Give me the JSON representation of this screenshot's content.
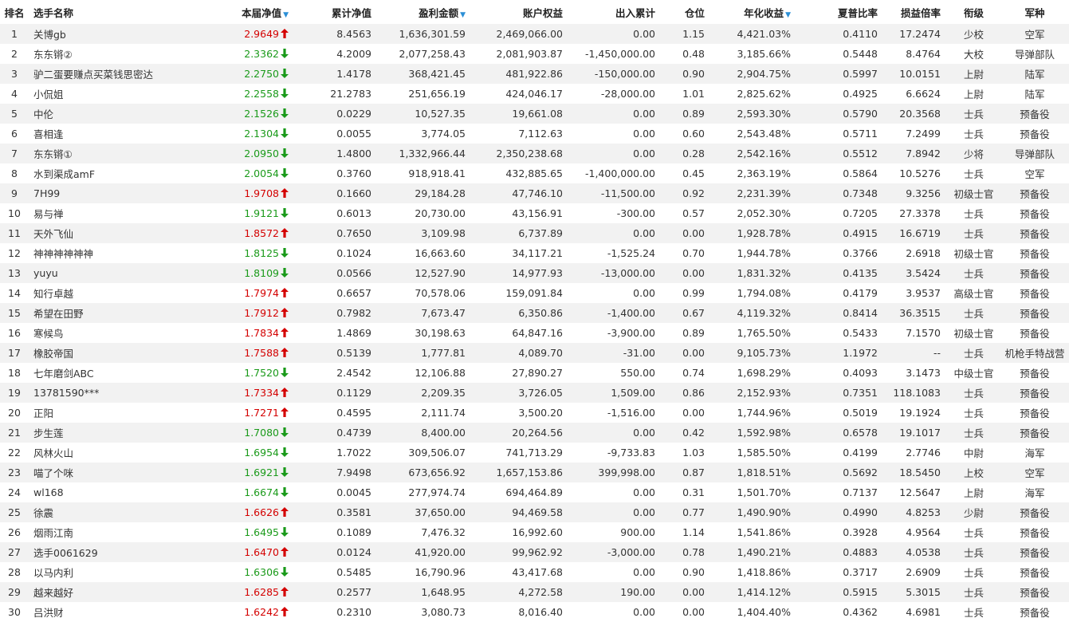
{
  "columns": {
    "rank": "排名",
    "name": "选手名称",
    "nav": "本届净值",
    "cum_nav": "累计净值",
    "profit": "盈利金额",
    "equity": "账户权益",
    "flow": "出入累计",
    "position": "仓位",
    "annual": "年化收益",
    "sharpe": "夏普比率",
    "pl_ratio": "损益倍率",
    "rank_title": "衔级",
    "army": "军种"
  },
  "sort_indicator": "▼",
  "icons": {
    "up": "arrow-up-icon",
    "down": "arrow-down-icon"
  },
  "colors": {
    "up": "#d40000",
    "down": "#1a9a1a",
    "sort": "#2b8fd6",
    "row_alt": "#f2f2f2"
  },
  "rows": [
    {
      "rank": "1",
      "name": "关博gb",
      "nav": "2.9649",
      "dir": "up",
      "cum": "8.4563",
      "profit": "1,636,301.59",
      "equity": "2,469,066.00",
      "flow": "0.00",
      "pos": "1.15",
      "annual": "4,421.03%",
      "sharpe": "0.4110",
      "pl": "17.2474",
      "title": "少校",
      "army": "空军"
    },
    {
      "rank": "2",
      "name": "东东锵②",
      "nav": "2.3362",
      "dir": "down",
      "cum": "4.2009",
      "profit": "2,077,258.43",
      "equity": "2,081,903.87",
      "flow": "-1,450,000.00",
      "pos": "0.48",
      "annual": "3,185.66%",
      "sharpe": "0.5448",
      "pl": "8.4764",
      "title": "大校",
      "army": "导弹部队"
    },
    {
      "rank": "3",
      "name": "驴二蛋要赚点买菜钱思密达",
      "nav": "2.2750",
      "dir": "down",
      "cum": "1.4178",
      "profit": "368,421.45",
      "equity": "481,922.86",
      "flow": "-150,000.00",
      "pos": "0.90",
      "annual": "2,904.75%",
      "sharpe": "0.5997",
      "pl": "10.0151",
      "title": "上尉",
      "army": "陆军"
    },
    {
      "rank": "4",
      "name": "小侃姐",
      "nav": "2.2558",
      "dir": "down",
      "cum": "21.2783",
      "profit": "251,656.19",
      "equity": "424,046.17",
      "flow": "-28,000.00",
      "pos": "1.01",
      "annual": "2,825.62%",
      "sharpe": "0.4925",
      "pl": "6.6624",
      "title": "上尉",
      "army": "陆军"
    },
    {
      "rank": "5",
      "name": "中伦",
      "nav": "2.1526",
      "dir": "down",
      "cum": "0.0229",
      "profit": "10,527.35",
      "equity": "19,661.08",
      "flow": "0.00",
      "pos": "0.89",
      "annual": "2,593.30%",
      "sharpe": "0.5790",
      "pl": "20.3568",
      "title": "士兵",
      "army": "预备役"
    },
    {
      "rank": "6",
      "name": "喜相逢",
      "nav": "2.1304",
      "dir": "down",
      "cum": "0.0055",
      "profit": "3,774.05",
      "equity": "7,112.63",
      "flow": "0.00",
      "pos": "0.60",
      "annual": "2,543.48%",
      "sharpe": "0.5711",
      "pl": "7.2499",
      "title": "士兵",
      "army": "预备役"
    },
    {
      "rank": "7",
      "name": "东东锵①",
      "nav": "2.0950",
      "dir": "down",
      "cum": "1.4800",
      "profit": "1,332,966.44",
      "equity": "2,350,238.68",
      "flow": "0.00",
      "pos": "0.28",
      "annual": "2,542.16%",
      "sharpe": "0.5512",
      "pl": "7.8942",
      "title": "少将",
      "army": "导弹部队"
    },
    {
      "rank": "8",
      "name": "水到渠成amF",
      "nav": "2.0054",
      "dir": "down",
      "cum": "0.3760",
      "profit": "918,918.41",
      "equity": "432,885.65",
      "flow": "-1,400,000.00",
      "pos": "0.45",
      "annual": "2,363.19%",
      "sharpe": "0.5864",
      "pl": "10.5276",
      "title": "士兵",
      "army": "空军"
    },
    {
      "rank": "9",
      "name": "7H99",
      "nav": "1.9708",
      "dir": "up",
      "cum": "0.1660",
      "profit": "29,184.28",
      "equity": "47,746.10",
      "flow": "-11,500.00",
      "pos": "0.92",
      "annual": "2,231.39%",
      "sharpe": "0.7348",
      "pl": "9.3256",
      "title": "初级士官",
      "army": "预备役"
    },
    {
      "rank": "10",
      "name": "易与禅",
      "nav": "1.9121",
      "dir": "down",
      "cum": "0.6013",
      "profit": "20,730.00",
      "equity": "43,156.91",
      "flow": "-300.00",
      "pos": "0.57",
      "annual": "2,052.30%",
      "sharpe": "0.7205",
      "pl": "27.3378",
      "title": "士兵",
      "army": "预备役"
    },
    {
      "rank": "11",
      "name": "天外飞仙",
      "nav": "1.8572",
      "dir": "up",
      "cum": "0.7650",
      "profit": "3,109.98",
      "equity": "6,737.89",
      "flow": "0.00",
      "pos": "0.00",
      "annual": "1,928.78%",
      "sharpe": "0.4915",
      "pl": "16.6719",
      "title": "士兵",
      "army": "预备役"
    },
    {
      "rank": "12",
      "name": "神神神神神神",
      "nav": "1.8125",
      "dir": "down",
      "cum": "0.1024",
      "profit": "16,663.60",
      "equity": "34,117.21",
      "flow": "-1,525.24",
      "pos": "0.70",
      "annual": "1,944.78%",
      "sharpe": "0.3766",
      "pl": "2.6918",
      "title": "初级士官",
      "army": "预备役"
    },
    {
      "rank": "13",
      "name": "yuyu",
      "nav": "1.8109",
      "dir": "down",
      "cum": "0.0566",
      "profit": "12,527.90",
      "equity": "14,977.93",
      "flow": "-13,000.00",
      "pos": "0.00",
      "annual": "1,831.32%",
      "sharpe": "0.4135",
      "pl": "3.5424",
      "title": "士兵",
      "army": "预备役"
    },
    {
      "rank": "14",
      "name": "知行卓越",
      "nav": "1.7974",
      "dir": "up",
      "cum": "0.6657",
      "profit": "70,578.06",
      "equity": "159,091.84",
      "flow": "0.00",
      "pos": "0.99",
      "annual": "1,794.08%",
      "sharpe": "0.4179",
      "pl": "3.9537",
      "title": "高级士官",
      "army": "预备役"
    },
    {
      "rank": "15",
      "name": "希望在田野",
      "nav": "1.7912",
      "dir": "up",
      "cum": "0.7982",
      "profit": "7,673.47",
      "equity": "6,350.86",
      "flow": "-1,400.00",
      "pos": "0.67",
      "annual": "4,119.32%",
      "sharpe": "0.8414",
      "pl": "36.3515",
      "title": "士兵",
      "army": "预备役"
    },
    {
      "rank": "16",
      "name": "寒候鸟",
      "nav": "1.7834",
      "dir": "up",
      "cum": "1.4869",
      "profit": "30,198.63",
      "equity": "64,847.16",
      "flow": "-3,900.00",
      "pos": "0.89",
      "annual": "1,765.50%",
      "sharpe": "0.5433",
      "pl": "7.1570",
      "title": "初级士官",
      "army": "预备役"
    },
    {
      "rank": "17",
      "name": "橡胶帝国",
      "nav": "1.7588",
      "dir": "up",
      "cum": "0.5139",
      "profit": "1,777.81",
      "equity": "4,089.70",
      "flow": "-31.00",
      "pos": "0.00",
      "annual": "9,105.73%",
      "sharpe": "1.1972",
      "pl": "--",
      "title": "士兵",
      "army": "机枪手特战营"
    },
    {
      "rank": "18",
      "name": "七年磨剑ABC",
      "nav": "1.7520",
      "dir": "down",
      "cum": "2.4542",
      "profit": "12,106.88",
      "equity": "27,890.27",
      "flow": "550.00",
      "pos": "0.74",
      "annual": "1,698.29%",
      "sharpe": "0.4093",
      "pl": "3.1473",
      "title": "中级士官",
      "army": "预备役"
    },
    {
      "rank": "19",
      "name": "13781590***",
      "nav": "1.7334",
      "dir": "up",
      "cum": "0.1129",
      "profit": "2,209.35",
      "equity": "3,726.05",
      "flow": "1,509.00",
      "pos": "0.86",
      "annual": "2,152.93%",
      "sharpe": "0.7351",
      "pl": "118.1083",
      "title": "士兵",
      "army": "预备役"
    },
    {
      "rank": "20",
      "name": "正阳",
      "nav": "1.7271",
      "dir": "up",
      "cum": "0.4595",
      "profit": "2,111.74",
      "equity": "3,500.20",
      "flow": "-1,516.00",
      "pos": "0.00",
      "annual": "1,744.96%",
      "sharpe": "0.5019",
      "pl": "19.1924",
      "title": "士兵",
      "army": "预备役"
    },
    {
      "rank": "21",
      "name": "步生莲",
      "nav": "1.7080",
      "dir": "down",
      "cum": "0.4739",
      "profit": "8,400.00",
      "equity": "20,264.56",
      "flow": "0.00",
      "pos": "0.42",
      "annual": "1,592.98%",
      "sharpe": "0.6578",
      "pl": "19.1017",
      "title": "士兵",
      "army": "预备役"
    },
    {
      "rank": "22",
      "name": "风林火山",
      "nav": "1.6954",
      "dir": "down",
      "cum": "1.7022",
      "profit": "309,506.07",
      "equity": "741,713.29",
      "flow": "-9,733.83",
      "pos": "1.03",
      "annual": "1,585.50%",
      "sharpe": "0.4199",
      "pl": "2.7746",
      "title": "中尉",
      "army": "海军"
    },
    {
      "rank": "23",
      "name": "喵了个咪",
      "nav": "1.6921",
      "dir": "down",
      "cum": "7.9498",
      "profit": "673,656.92",
      "equity": "1,657,153.86",
      "flow": "399,998.00",
      "pos": "0.87",
      "annual": "1,818.51%",
      "sharpe": "0.5692",
      "pl": "18.5450",
      "title": "上校",
      "army": "空军"
    },
    {
      "rank": "24",
      "name": "wl168",
      "nav": "1.6674",
      "dir": "down",
      "cum": "0.0045",
      "profit": "277,974.74",
      "equity": "694,464.89",
      "flow": "0.00",
      "pos": "0.31",
      "annual": "1,501.70%",
      "sharpe": "0.7137",
      "pl": "12.5647",
      "title": "上尉",
      "army": "海军"
    },
    {
      "rank": "25",
      "name": "徐震",
      "nav": "1.6626",
      "dir": "up",
      "cum": "0.3581",
      "profit": "37,650.00",
      "equity": "94,469.58",
      "flow": "0.00",
      "pos": "0.77",
      "annual": "1,490.90%",
      "sharpe": "0.4990",
      "pl": "4.8253",
      "title": "少尉",
      "army": "预备役"
    },
    {
      "rank": "26",
      "name": "烟雨江南",
      "nav": "1.6495",
      "dir": "down",
      "cum": "0.1089",
      "profit": "7,476.32",
      "equity": "16,992.60",
      "flow": "900.00",
      "pos": "1.14",
      "annual": "1,541.86%",
      "sharpe": "0.3928",
      "pl": "4.9564",
      "title": "士兵",
      "army": "预备役"
    },
    {
      "rank": "27",
      "name": "选手0061629",
      "nav": "1.6470",
      "dir": "up",
      "cum": "0.0124",
      "profit": "41,920.00",
      "equity": "99,962.92",
      "flow": "-3,000.00",
      "pos": "0.78",
      "annual": "1,490.21%",
      "sharpe": "0.4883",
      "pl": "4.0538",
      "title": "士兵",
      "army": "预备役"
    },
    {
      "rank": "28",
      "name": "以马内利",
      "nav": "1.6306",
      "dir": "down",
      "cum": "0.5485",
      "profit": "16,790.96",
      "equity": "43,417.68",
      "flow": "0.00",
      "pos": "0.90",
      "annual": "1,418.86%",
      "sharpe": "0.3717",
      "pl": "2.6909",
      "title": "士兵",
      "army": "预备役"
    },
    {
      "rank": "29",
      "name": "越来越好",
      "nav": "1.6285",
      "dir": "up",
      "cum": "0.2577",
      "profit": "1,648.95",
      "equity": "4,272.58",
      "flow": "190.00",
      "pos": "0.00",
      "annual": "1,414.12%",
      "sharpe": "0.5915",
      "pl": "5.3015",
      "title": "士兵",
      "army": "预备役"
    },
    {
      "rank": "30",
      "name": "吕洪财",
      "nav": "1.6242",
      "dir": "up",
      "cum": "0.2310",
      "profit": "3,080.73",
      "equity": "8,016.40",
      "flow": "0.00",
      "pos": "0.00",
      "annual": "1,404.40%",
      "sharpe": "0.4362",
      "pl": "4.6981",
      "title": "士兵",
      "army": "预备役"
    }
  ]
}
